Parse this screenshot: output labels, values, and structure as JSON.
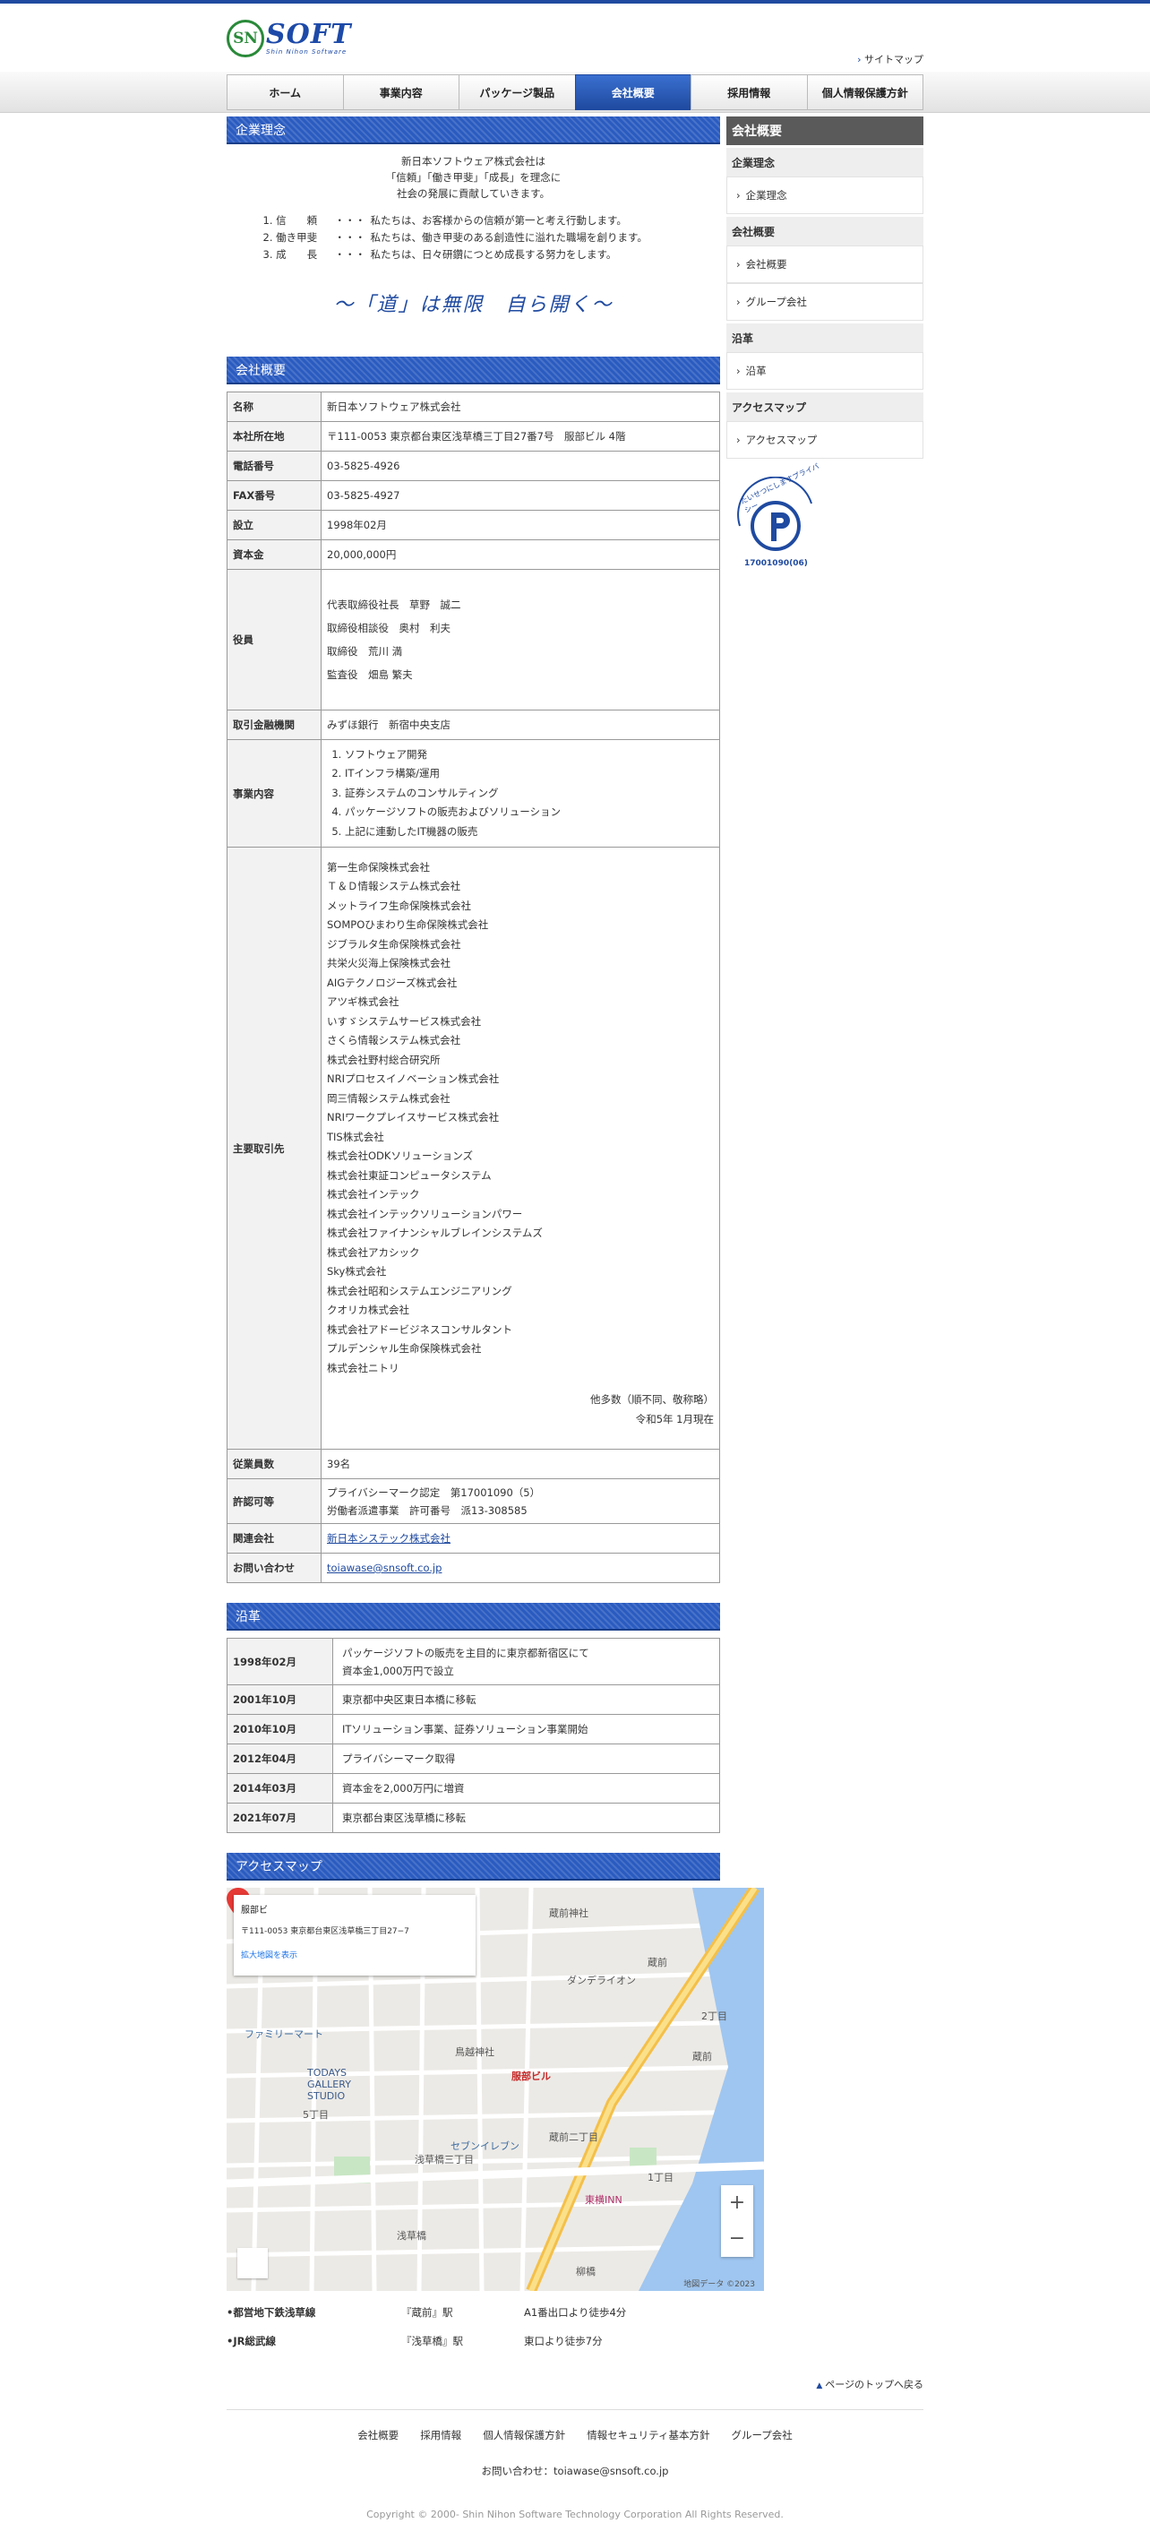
{
  "header": {
    "logo_mark": "SN",
    "logo_text": "SOFT",
    "logo_sub": "Shin Nihon Software",
    "sitemap": "サイトマップ"
  },
  "nav": [
    "ホーム",
    "事業内容",
    "パッケージ製品",
    "会社概要",
    "採用情報",
    "個人情報保護方針"
  ],
  "nav_active": 3,
  "philosophy": {
    "heading": "企業理念",
    "lines": [
      "新日本ソフトウェア株式会社は",
      "「信頼」「働き甲斐」「成長」を理念に",
      "社会の発展に貢献していきます。"
    ],
    "items": [
      {
        "key": "1. 信　　頼",
        "dots": "・・・",
        "desc": "私たちは、お客様からの信頼が第一と考え行動します。"
      },
      {
        "key": "2. 働き甲斐",
        "dots": "・・・",
        "desc": "私たちは、働き甲斐のある創造性に溢れた職場を創ります。"
      },
      {
        "key": "3. 成　　長",
        "dots": "・・・",
        "desc": "私たちは、日々研鑽につとめ成長する努力をします。"
      }
    ],
    "motto": "〜「道」は無限　自ら開く〜"
  },
  "overview": {
    "heading": "会社概要",
    "name_label": "名称",
    "name": "新日本ソフトウェア株式会社",
    "address_label": "本社所在地",
    "address": "〒111-0053 東京都台東区浅草橋三丁目27番7号　服部ビル 4階",
    "tel_label": "電話番号",
    "tel": "03-5825-4926",
    "fax_label": "FAX番号",
    "fax": "03-5825-4927",
    "founded_label": "設立",
    "founded": "1998年02月",
    "capital_label": "資本金",
    "capital": "20,000,000円",
    "officers_label": "役員",
    "officers": [
      "代表取締役社長　草野　誠二",
      "取締役相談役　奥村　利夫",
      "取締役　荒川 満",
      "監査役　畑島 繁夫"
    ],
    "bank_label": "取引金融機関",
    "bank": "みずほ銀行　新宿中央支店",
    "business_label": "事業内容",
    "business": [
      "ソフトウェア開発",
      "ITインフラ構築/運用",
      "証券システムのコンサルティング",
      "パッケージソフトの販売およびソリューション",
      "上記に連動したIT機器の販売"
    ],
    "clients_label": "主要取引先",
    "clients": [
      "第一生命保険株式会社",
      "Ｔ＆Ｄ情報システム株式会社",
      "メットライフ生命保険株式会社",
      "SOMPOひまわり生命保険株式会社",
      "ジブラルタ生命保険株式会社",
      "共栄火災海上保険株式会社",
      "AIGテクノロジーズ株式会社",
      "アツギ株式会社",
      "いすゞシステムサービス株式会社",
      "さくら情報システム株式会社",
      "株式会社野村総合研究所",
      "NRIプロセスイノベーション株式会社",
      "岡三情報システム株式会社",
      "NRIワークプレイスサービス株式会社",
      "TIS株式会社",
      "株式会社ODKソリューションズ",
      "株式会社東証コンピュータシステム",
      "株式会社インテック",
      "株式会社インテックソリューションパワー",
      "株式会社ファイナンシャルブレインシステムズ",
      "株式会社アカシック",
      "Sky株式会社",
      "株式会社昭和システムエンジニアリング",
      "クオリカ株式会社",
      "株式会社アドービジネスコンサルタント",
      "プルデンシャル生命保険株式会社",
      "株式会社ニトリ"
    ],
    "clients_note1": "他多数（順不同、敬称略）",
    "clients_note2": "令和5年 1月現在",
    "staff_label": "従業員数",
    "staff": "39名",
    "license_label": "許認可等",
    "license1": "プライバシーマーク認定　第17001090（5）",
    "license2": "労働者派遣事業　許可番号　派13-308585",
    "related_label": "関連会社",
    "related": "新日本システック株式会社",
    "inquiry_label": "お問い合わせ",
    "inquiry": "toiawase@snsoft.co.jp"
  },
  "history": {
    "heading": "沿革",
    "rows": [
      {
        "date": "1998年02月",
        "text1": "パッケージソフトの販売を主目的に東京都新宿区にて",
        "text2": "資本金1,000万円で設立"
      },
      {
        "date": "2001年10月",
        "text1": "東京都中央区東日本橋に移転",
        "text2": ""
      },
      {
        "date": "2010年10月",
        "text1": "ITソリューション事業、証券ソリューション事業開始",
        "text2": ""
      },
      {
        "date": "2012年04月",
        "text1": "プライバシーマーク取得",
        "text2": ""
      },
      {
        "date": "2014年03月",
        "text1": "資本金を2,000万円に増資",
        "text2": ""
      },
      {
        "date": "2021年07月",
        "text1": "東京都台東区浅草橋に移転",
        "text2": ""
      }
    ]
  },
  "access": {
    "heading": "アクセスマップ",
    "map": {
      "box_title": "服部ビ",
      "box_address": "〒111-0053 東京都台東区浅草橋三丁目27−7",
      "box_link": "拡大地図を表示",
      "pin_label": "服部ビル",
      "labels": [
        "蔵前神社",
        "浅草橋三丁目",
        "蔵前",
        "浅草橋",
        "柳橋",
        "鳥越神社",
        "TODAYS GALLERY STUDIO",
        "ファミリーマート",
        "セブンイレブン",
        "東横INN",
        "蔵前二丁目",
        "ダンデライオン",
        "1丁目",
        "5丁目",
        "2丁目"
      ],
      "copyright": "地図データ ©2023"
    },
    "routes": [
      {
        "line": "•都営地下鉄浅草線",
        "station": "『蔵前』駅",
        "exit": "A1番出口より徒歩4分"
      },
      {
        "line": "•JR総武線",
        "station": "『浅草橋』駅",
        "exit": "東口より徒歩7分"
      }
    ]
  },
  "totop": "ページのトップへ戻る",
  "footer": {
    "links": [
      "会社概要",
      "採用情報",
      "個人情報保護方針",
      "情報セキュリティ基本方針",
      "グループ会社"
    ],
    "contact": "お問い合わせ：toiawase@snsoft.co.jp",
    "copyright": "Copyright © 2000- Shin Nihon Software Technology Corporation All Rights Reserved."
  },
  "sidebar": {
    "heading": "会社概要",
    "sections": [
      {
        "title": "企業理念",
        "items": [
          "企業理念"
        ]
      },
      {
        "title": "会社概要",
        "items": [
          "会社概要",
          "グループ会社"
        ]
      },
      {
        "title": "沿革",
        "items": [
          "沿革"
        ]
      },
      {
        "title": "アクセスマップ",
        "items": [
          "アクセスマップ"
        ]
      }
    ],
    "pmark_text": "たいせつにしますプライバシー",
    "pmark_num": "17001090(06)"
  },
  "colors": {
    "brand": "#1f4aa0",
    "accent_green": "#2a8a3a"
  }
}
